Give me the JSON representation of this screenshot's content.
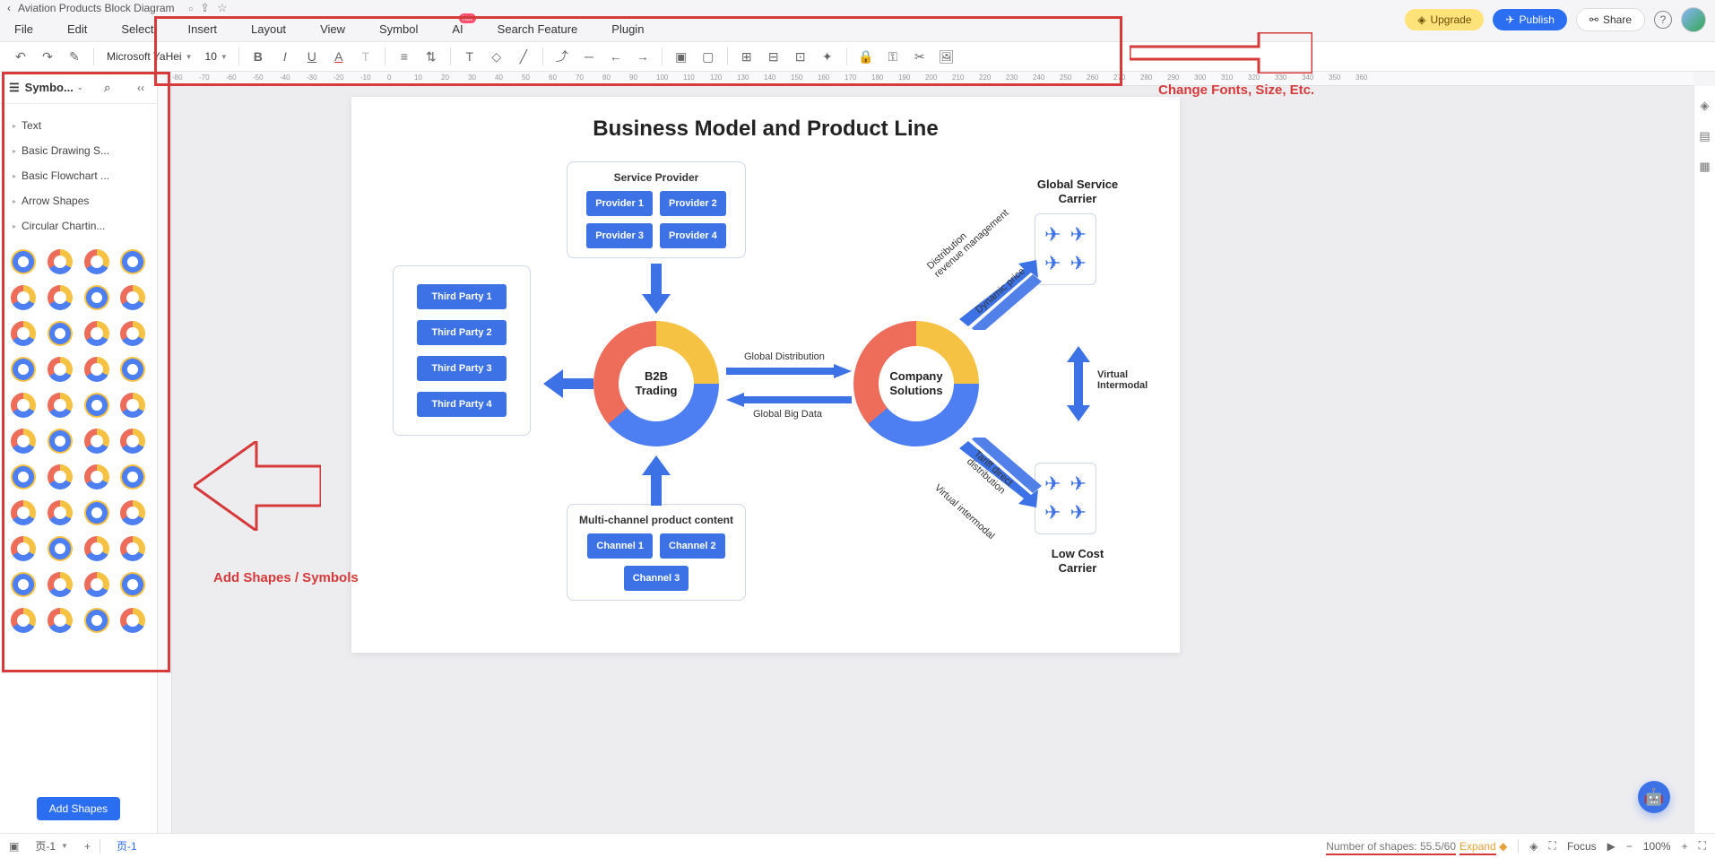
{
  "doc": {
    "title": "Aviation Products Block Diagram"
  },
  "actions": {
    "upgrade": "Upgrade",
    "publish": "Publish",
    "share": "Share"
  },
  "menu": [
    "File",
    "Edit",
    "Select",
    "Insert",
    "Layout",
    "View",
    "Symbol",
    "AI",
    "Search Feature",
    "Plugin"
  ],
  "hot_badge": "hot",
  "toolbar": {
    "font": "Microsoft YaHei",
    "size": "10"
  },
  "sidebar": {
    "title": "Symbo...",
    "categories": [
      "Text",
      "Basic Drawing S...",
      "Basic Flowchart ...",
      "Arrow Shapes",
      "Circular Chartin..."
    ],
    "add_shapes": "Add Shapes"
  },
  "ruler_ticks": [
    "-80",
    "-70",
    "-60",
    "-50",
    "-40",
    "-30",
    "-20",
    "-10",
    "0",
    "10",
    "20",
    "30",
    "40",
    "50",
    "60",
    "70",
    "80",
    "90",
    "100",
    "110",
    "120",
    "130",
    "140",
    "150",
    "160",
    "170",
    "180",
    "190",
    "200",
    "210",
    "220",
    "230",
    "240",
    "250",
    "260",
    "270",
    "280",
    "290",
    "300",
    "310",
    "320",
    "330",
    "340",
    "350",
    "360"
  ],
  "diagram": {
    "title": "Business Model and Product Line",
    "service_provider": {
      "title": "Service Provider",
      "items": [
        "Provider 1",
        "Provider 2",
        "Provider 3",
        "Provider 4"
      ]
    },
    "third_party": {
      "items": [
        "Third Party 1",
        "Third Party 2",
        "Third Party 3",
        "Third Party 4"
      ]
    },
    "multi_channel": {
      "title": "Multi-channel product content",
      "items": [
        "Channel 1",
        "Channel 2",
        "Channel 3"
      ]
    },
    "donut1": "B2B\nTrading",
    "donut2": "Company\nSolutions",
    "labels": {
      "global_dist": "Global Distribution",
      "global_bigdata": "Global Big Data",
      "dist_rev": "Distribution\nrevenue management",
      "dyn_price": "Dynamic price",
      "tariff": "Tariff direct\ndistribution",
      "virtual_im": "Virtual intermodal",
      "virtual_intermodal": "Virtual\nIntermodal",
      "gsc": "Global Service\nCarrier",
      "lcc": "Low Cost\nCarrier"
    }
  },
  "bottom": {
    "page_tab_left": "页-1",
    "page_tab_canvas": "页-1",
    "shapes_count": "Number of shapes: 55.5/60",
    "expand": "Expand",
    "focus": "Focus",
    "zoom": "100%"
  },
  "annotations": {
    "change_fonts": "Change Fonts, Size, Etc.",
    "add_shapes": "Add Shapes / Symbols"
  }
}
